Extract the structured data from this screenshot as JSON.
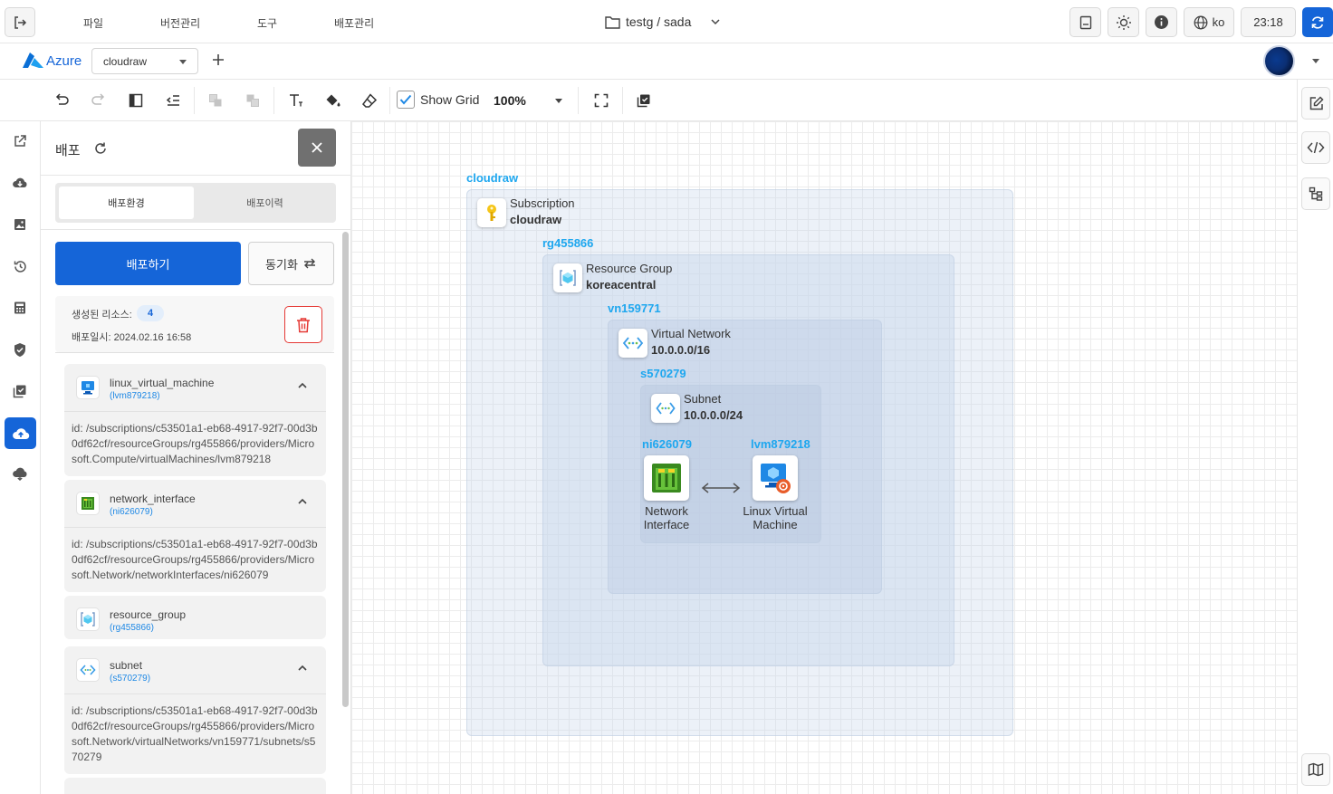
{
  "menu": {
    "file": "파일",
    "version": "버전관리",
    "tools": "도구",
    "deploy": "배포관리"
  },
  "project": {
    "path": "testg / sada"
  },
  "topright": {
    "lang": "ko",
    "time": "23:18"
  },
  "provider": {
    "name": "Azure",
    "selected": "cloudraw"
  },
  "toolbar": {
    "show_grid": "Show Grid",
    "zoom": "100%"
  },
  "panel": {
    "title": "배포",
    "tabs": [
      "배포환경",
      "배포이력"
    ],
    "deploy_btn": "배포하기",
    "sync_btn": "동기화",
    "created_label": "생성된 리소스:",
    "created_count": "4",
    "deployed_at": "배포일시: 2024.02.16 16:58",
    "resources": [
      {
        "name": "linux_virtual_machine",
        "id": "(lvm879218)",
        "icon": "linux-vm-icon",
        "detail": "id: /subscriptions/c53501a1-eb68-4917-92f7-00d3b0df62cf/resourceGroups/rg455866/providers/Microsoft.Compute/virtualMachines/lvm879218"
      },
      {
        "name": "network_interface",
        "id": "(ni626079)",
        "icon": "network-interface-icon",
        "detail": "id: /subscriptions/c53501a1-eb68-4917-92f7-00d3b0df62cf/resourceGroups/rg455866/providers/Microsoft.Network/networkInterfaces/ni626079"
      },
      {
        "name": "resource_group",
        "id": "(rg455866)",
        "icon": "resource-group-icon",
        "detail": ""
      },
      {
        "name": "subnet",
        "id": "(s570279)",
        "icon": "subnet-icon",
        "detail": "id: /subscriptions/c53501a1-eb68-4917-92f7-00d3b0df62cf/resourceGroups/rg455866/providers/Microsoft.Network/virtualNetworks/vn159771/subnets/s570279"
      }
    ]
  },
  "diagram": {
    "root_label": "cloudraw",
    "subscription": {
      "type": "Subscription",
      "name": "cloudraw"
    },
    "rg": {
      "label": "rg455866",
      "type": "Resource Group",
      "name": "koreacentral"
    },
    "vnet": {
      "label": "vn159771",
      "type": "Virtual Network",
      "name": "10.0.0.0/16"
    },
    "subnet": {
      "label": "s570279",
      "type": "Subnet",
      "name": "10.0.0.0/24"
    },
    "nic": {
      "label": "ni626079",
      "line1": "Network",
      "line2": "Interface"
    },
    "vm": {
      "label": "lvm879218",
      "line1": "Linux Virtual",
      "line2": "Machine"
    }
  },
  "colors": {
    "accent": "#1565d8",
    "label_blue": "#1ea7ef",
    "delete_red": "#e53935"
  }
}
